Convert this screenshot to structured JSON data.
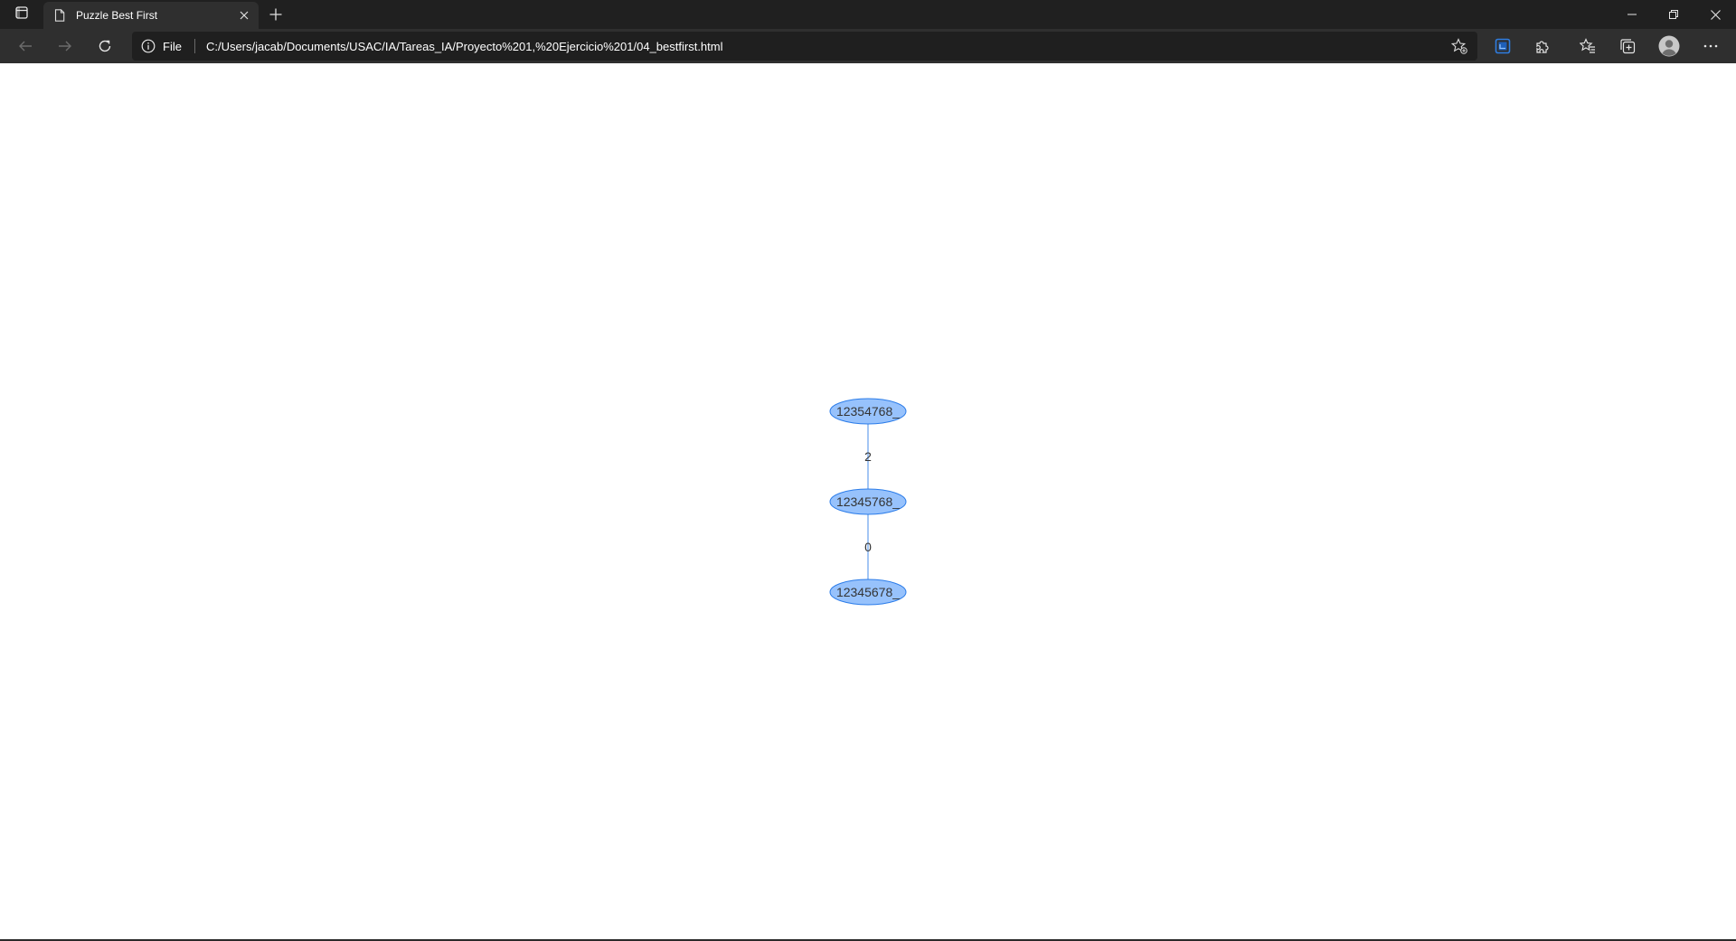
{
  "browser": {
    "tab": {
      "title": "Puzzle Best First"
    },
    "address": {
      "site_label": "File",
      "url": "C:/Users/jacab/Documents/USAC/IA/Tareas_IA/Proyecto%201,%20Ejercicio%201/04_bestfirst.html"
    },
    "icons": {
      "tab_actions": "tab-actions-icon",
      "favicon": "page-icon",
      "close_tab": "close-icon",
      "new_tab": "plus-icon",
      "back": "arrow-left-icon",
      "forward": "arrow-right-icon",
      "refresh": "refresh-icon",
      "info": "info-icon",
      "add_favorite": "star-add-icon",
      "extension_active": "extension-badge-icon",
      "extensions": "puzzle-icon",
      "favorites": "favorites-icon",
      "collections": "collections-icon",
      "profile": "avatar-icon",
      "menu": "more-icon",
      "minimize": "minimize-icon",
      "restore": "restore-icon",
      "close_window": "close-icon"
    }
  },
  "graph": {
    "nodes": [
      {
        "id": "12354768_",
        "label": "12354768_"
      },
      {
        "id": "12345768_",
        "label": "12345768_"
      },
      {
        "id": "12345678_",
        "label": "12345678_"
      }
    ],
    "edges": [
      {
        "from": "12354768_",
        "to": "12345768_",
        "label": "2"
      },
      {
        "from": "12345768_",
        "to": "12345678_",
        "label": "0"
      }
    ],
    "colors": {
      "node_fill": "#97c2fc",
      "node_border": "#2b7ce9",
      "edge": "#84b2f0",
      "label": "#343434"
    }
  }
}
